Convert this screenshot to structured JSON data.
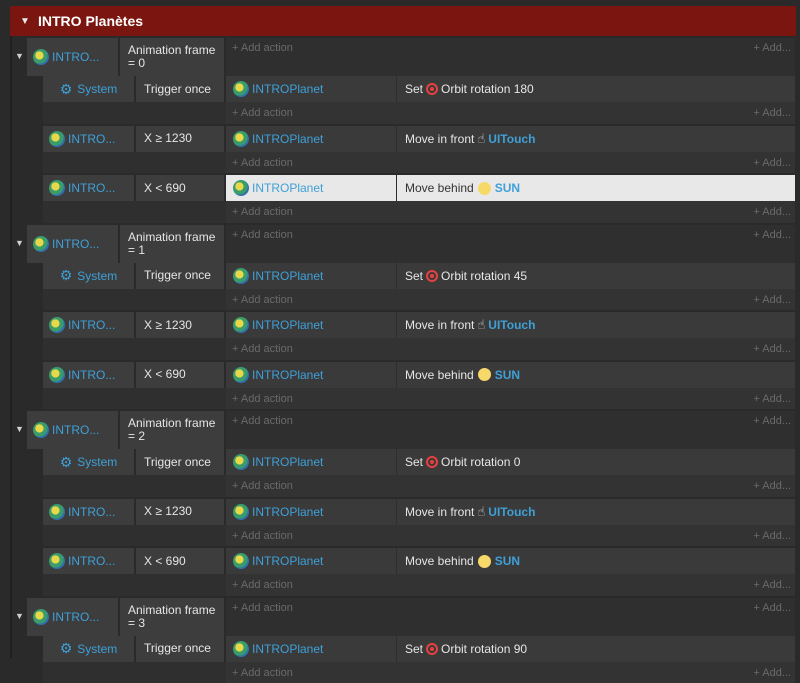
{
  "group": {
    "title": "INTRO Planètes"
  },
  "labels": {
    "add_action": "Add action",
    "add_more": "Add..."
  },
  "frames": [
    {
      "object": "INTRO...",
      "condition": "Animation frame = 0",
      "subs": [
        {
          "object": "System",
          "condition": "Trigger once",
          "action_object": "INTROPlanet",
          "verb": "Set",
          "icon": "orbit-icon",
          "detail": "Orbit rotation 180",
          "target": ""
        },
        {
          "object": "INTRO...",
          "condition": "X ≥ 1230",
          "action_object": "INTROPlanet",
          "verb": "Move in front",
          "icon": "touch-icon",
          "detail": "",
          "target": "UITouch"
        },
        {
          "object": "INTRO...",
          "condition": "X < 690",
          "action_object": "INTROPlanet",
          "verb": "Move behind",
          "icon": "sun-icon",
          "detail": "",
          "target": "SUN"
        }
      ]
    },
    {
      "object": "INTRO...",
      "condition": "Animation frame = 1",
      "subs": [
        {
          "object": "System",
          "condition": "Trigger once",
          "action_object": "INTROPlanet",
          "verb": "Set",
          "icon": "orbit-icon",
          "detail": "Orbit rotation 45",
          "target": ""
        },
        {
          "object": "INTRO...",
          "condition": "X ≥ 1230",
          "action_object": "INTROPlanet",
          "verb": "Move in front",
          "icon": "touch-icon",
          "detail": "",
          "target": "UITouch"
        },
        {
          "object": "INTRO...",
          "condition": "X < 690",
          "action_object": "INTROPlanet",
          "verb": "Move behind",
          "icon": "sun-icon",
          "detail": "",
          "target": "SUN"
        }
      ]
    },
    {
      "object": "INTRO...",
      "condition": "Animation frame = 2",
      "subs": [
        {
          "object": "System",
          "condition": "Trigger once",
          "action_object": "INTROPlanet",
          "verb": "Set",
          "icon": "orbit-icon",
          "detail": "Orbit rotation 0",
          "target": ""
        },
        {
          "object": "INTRO...",
          "condition": "X ≥ 1230",
          "action_object": "INTROPlanet",
          "verb": "Move in front",
          "icon": "touch-icon",
          "detail": "",
          "target": "UITouch"
        },
        {
          "object": "INTRO...",
          "condition": "X < 690",
          "action_object": "INTROPlanet",
          "verb": "Move behind",
          "icon": "sun-icon",
          "detail": "",
          "target": "SUN"
        }
      ]
    },
    {
      "object": "INTRO...",
      "condition": "Animation frame = 3",
      "subs": [
        {
          "object": "System",
          "condition": "Trigger once",
          "action_object": "INTROPlanet",
          "verb": "Set",
          "icon": "orbit-icon",
          "detail": "Orbit rotation 90",
          "target": ""
        }
      ]
    }
  ],
  "highlighted": {
    "frame": 0,
    "sub": 2
  },
  "colors": {
    "header": "#7a160f",
    "link": "#3fa0d8",
    "orbit": "#e84040",
    "sun": "#f7d96a"
  }
}
